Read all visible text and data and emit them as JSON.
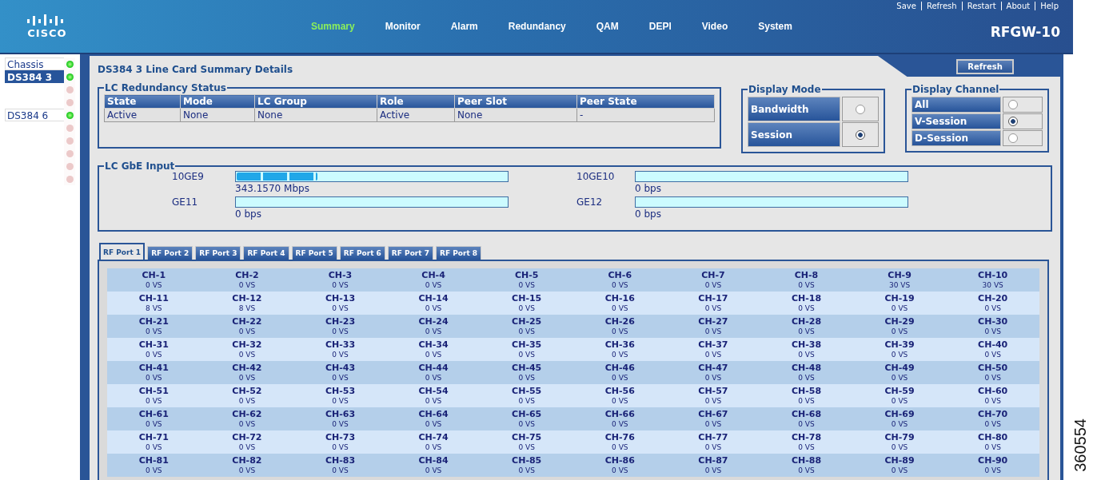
{
  "header": {
    "logo": "CISCO",
    "links": [
      "Save",
      "Refresh",
      "Restart",
      "About",
      "Help"
    ],
    "nav": [
      {
        "label": "Summary",
        "selected": true
      },
      {
        "label": "Monitor",
        "selected": false
      },
      {
        "label": "Alarm",
        "selected": false
      },
      {
        "label": "Redundancy",
        "selected": false
      },
      {
        "label": "QAM",
        "selected": false
      },
      {
        "label": "DEPI",
        "selected": false
      },
      {
        "label": "Video",
        "selected": false
      },
      {
        "label": "System",
        "selected": false
      }
    ],
    "device": "RFGW-10"
  },
  "sidebar": {
    "items": [
      {
        "label": "Chassis",
        "selected": false,
        "led_on": true
      },
      {
        "label": "DS384 3",
        "selected": true,
        "led_on": true
      },
      {
        "led_on": false
      },
      {
        "led_on": false
      },
      {
        "label": "DS384 6",
        "selected": false,
        "led_on": true
      },
      {
        "led_on": false
      },
      {
        "led_on": false
      },
      {
        "led_on": false
      },
      {
        "led_on": false
      },
      {
        "led_on": false
      }
    ]
  },
  "page_title": "DS384 3 Line Card Summary Details",
  "refresh_button": "Refresh",
  "redundancy": {
    "legend": "LC Redundancy Status",
    "columns": [
      "State",
      "Mode",
      "LC Group",
      "Role",
      "Peer Slot",
      "Peer State"
    ],
    "rows": [
      [
        "Active",
        "None",
        "None",
        "Active",
        "None",
        "-"
      ]
    ]
  },
  "display_mode": {
    "legend": "Display Mode",
    "options": [
      {
        "label": "Bandwidth",
        "selected": false
      },
      {
        "label": "Session",
        "selected": true
      }
    ]
  },
  "display_channel": {
    "legend": "Display Channel",
    "options": [
      {
        "label": "All",
        "selected": false
      },
      {
        "label": "V-Session",
        "selected": true
      },
      {
        "label": "D-Session",
        "selected": false
      }
    ]
  },
  "gbe": {
    "legend": "LC GbE Input",
    "ports": [
      {
        "name": "10GE9",
        "level": 0.3,
        "reading": "343.1570 Mbps"
      },
      {
        "name": "10GE10",
        "level": 0,
        "reading": "0 bps"
      },
      {
        "name": "GE11",
        "level": 0,
        "reading": "0 bps"
      },
      {
        "name": "GE12",
        "level": 0,
        "reading": "0 bps"
      }
    ]
  },
  "rf_tabs": [
    {
      "label": "RF Port 1",
      "selected": true
    },
    {
      "label": "RF Port 2",
      "selected": false
    },
    {
      "label": "RF Port 3",
      "selected": false
    },
    {
      "label": "RF Port 4",
      "selected": false
    },
    {
      "label": "RF Port 5",
      "selected": false
    },
    {
      "label": "RF Port 6",
      "selected": false
    },
    {
      "label": "RF Port 7",
      "selected": false
    },
    {
      "label": "RF Port 8",
      "selected": false
    }
  ],
  "channel_rows": [
    [
      {
        "name": "CH-1",
        "sessions": "0 VS"
      },
      {
        "name": "CH-2",
        "sessions": "0 VS"
      },
      {
        "name": "CH-3",
        "sessions": "0 VS"
      },
      {
        "name": "CH-4",
        "sessions": "0 VS"
      },
      {
        "name": "CH-5",
        "sessions": "0 VS"
      },
      {
        "name": "CH-6",
        "sessions": "0 VS"
      },
      {
        "name": "CH-7",
        "sessions": "0 VS"
      },
      {
        "name": "CH-8",
        "sessions": "0 VS"
      },
      {
        "name": "CH-9",
        "sessions": "30 VS"
      },
      {
        "name": "CH-10",
        "sessions": "30 VS"
      }
    ],
    [
      {
        "name": "CH-11",
        "sessions": "8 VS"
      },
      {
        "name": "CH-12",
        "sessions": "8 VS"
      },
      {
        "name": "CH-13",
        "sessions": "0 VS"
      },
      {
        "name": "CH-14",
        "sessions": "0 VS"
      },
      {
        "name": "CH-15",
        "sessions": "0 VS"
      },
      {
        "name": "CH-16",
        "sessions": "0 VS"
      },
      {
        "name": "CH-17",
        "sessions": "0 VS"
      },
      {
        "name": "CH-18",
        "sessions": "0 VS"
      },
      {
        "name": "CH-19",
        "sessions": "0 VS"
      },
      {
        "name": "CH-20",
        "sessions": "0 VS"
      }
    ],
    [
      {
        "name": "CH-21",
        "sessions": "0 VS"
      },
      {
        "name": "CH-22",
        "sessions": "0 VS"
      },
      {
        "name": "CH-23",
        "sessions": "0 VS"
      },
      {
        "name": "CH-24",
        "sessions": "0 VS"
      },
      {
        "name": "CH-25",
        "sessions": "0 VS"
      },
      {
        "name": "CH-26",
        "sessions": "0 VS"
      },
      {
        "name": "CH-27",
        "sessions": "0 VS"
      },
      {
        "name": "CH-28",
        "sessions": "0 VS"
      },
      {
        "name": "CH-29",
        "sessions": "0 VS"
      },
      {
        "name": "CH-30",
        "sessions": "0 VS"
      }
    ],
    [
      {
        "name": "CH-31",
        "sessions": "0 VS"
      },
      {
        "name": "CH-32",
        "sessions": "0 VS"
      },
      {
        "name": "CH-33",
        "sessions": "0 VS"
      },
      {
        "name": "CH-34",
        "sessions": "0 VS"
      },
      {
        "name": "CH-35",
        "sessions": "0 VS"
      },
      {
        "name": "CH-36",
        "sessions": "0 VS"
      },
      {
        "name": "CH-37",
        "sessions": "0 VS"
      },
      {
        "name": "CH-38",
        "sessions": "0 VS"
      },
      {
        "name": "CH-39",
        "sessions": "0 VS"
      },
      {
        "name": "CH-40",
        "sessions": "0 VS"
      }
    ],
    [
      {
        "name": "CH-41",
        "sessions": "0 VS"
      },
      {
        "name": "CH-42",
        "sessions": "0 VS"
      },
      {
        "name": "CH-43",
        "sessions": "0 VS"
      },
      {
        "name": "CH-44",
        "sessions": "0 VS"
      },
      {
        "name": "CH-45",
        "sessions": "0 VS"
      },
      {
        "name": "CH-46",
        "sessions": "0 VS"
      },
      {
        "name": "CH-47",
        "sessions": "0 VS"
      },
      {
        "name": "CH-48",
        "sessions": "0 VS"
      },
      {
        "name": "CH-49",
        "sessions": "0 VS"
      },
      {
        "name": "CH-50",
        "sessions": "0 VS"
      }
    ],
    [
      {
        "name": "CH-51",
        "sessions": "0 VS"
      },
      {
        "name": "CH-52",
        "sessions": "0 VS"
      },
      {
        "name": "CH-53",
        "sessions": "0 VS"
      },
      {
        "name": "CH-54",
        "sessions": "0 VS"
      },
      {
        "name": "CH-55",
        "sessions": "0 VS"
      },
      {
        "name": "CH-56",
        "sessions": "0 VS"
      },
      {
        "name": "CH-57",
        "sessions": "0 VS"
      },
      {
        "name": "CH-58",
        "sessions": "0 VS"
      },
      {
        "name": "CH-59",
        "sessions": "0 VS"
      },
      {
        "name": "CH-60",
        "sessions": "0 VS"
      }
    ],
    [
      {
        "name": "CH-61",
        "sessions": "0 VS"
      },
      {
        "name": "CH-62",
        "sessions": "0 VS"
      },
      {
        "name": "CH-63",
        "sessions": "0 VS"
      },
      {
        "name": "CH-64",
        "sessions": "0 VS"
      },
      {
        "name": "CH-65",
        "sessions": "0 VS"
      },
      {
        "name": "CH-66",
        "sessions": "0 VS"
      },
      {
        "name": "CH-67",
        "sessions": "0 VS"
      },
      {
        "name": "CH-68",
        "sessions": "0 VS"
      },
      {
        "name": "CH-69",
        "sessions": "0 VS"
      },
      {
        "name": "CH-70",
        "sessions": "0 VS"
      }
    ],
    [
      {
        "name": "CH-71",
        "sessions": "0 VS"
      },
      {
        "name": "CH-72",
        "sessions": "0 VS"
      },
      {
        "name": "CH-73",
        "sessions": "0 VS"
      },
      {
        "name": "CH-74",
        "sessions": "0 VS"
      },
      {
        "name": "CH-75",
        "sessions": "0 VS"
      },
      {
        "name": "CH-76",
        "sessions": "0 VS"
      },
      {
        "name": "CH-77",
        "sessions": "0 VS"
      },
      {
        "name": "CH-78",
        "sessions": "0 VS"
      },
      {
        "name": "CH-79",
        "sessions": "0 VS"
      },
      {
        "name": "CH-80",
        "sessions": "0 VS"
      }
    ],
    [
      {
        "name": "CH-81",
        "sessions": "0 VS"
      },
      {
        "name": "CH-82",
        "sessions": "0 VS"
      },
      {
        "name": "CH-83",
        "sessions": "0 VS"
      },
      {
        "name": "CH-84",
        "sessions": "0 VS"
      },
      {
        "name": "CH-85",
        "sessions": "0 VS"
      },
      {
        "name": "CH-86",
        "sessions": "0 VS"
      },
      {
        "name": "CH-87",
        "sessions": "0 VS"
      },
      {
        "name": "CH-88",
        "sessions": "0 VS"
      },
      {
        "name": "CH-89",
        "sessions": "0 VS"
      },
      {
        "name": "CH-90",
        "sessions": "0 VS"
      }
    ]
  ],
  "figure_id": "360554"
}
